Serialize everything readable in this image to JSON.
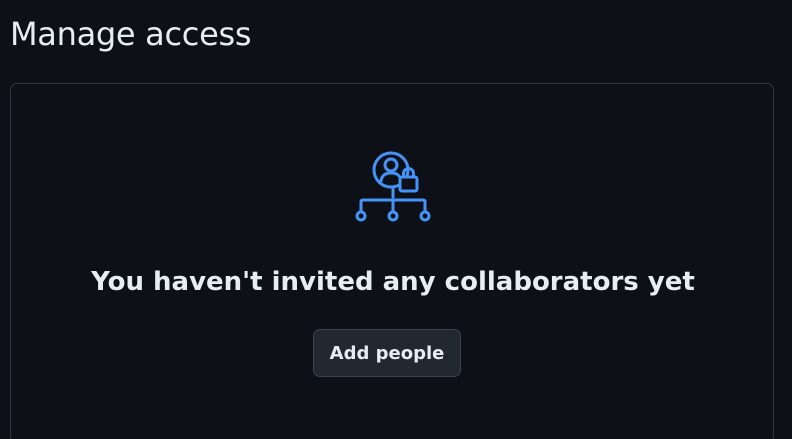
{
  "page": {
    "title": "Manage access"
  },
  "blankslate": {
    "icon": "person-lock-network-icon",
    "heading": "You haven't invited any collaborators yet",
    "button_label": "Add people"
  },
  "colors": {
    "background": "#0d1117",
    "border": "#30363d",
    "text": "#e6edf3",
    "icon_accent": "#4493f8",
    "button_bg": "#212830"
  }
}
